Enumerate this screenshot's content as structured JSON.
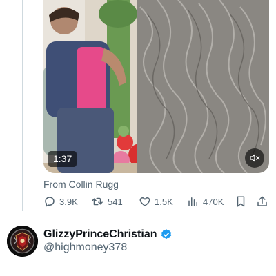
{
  "tweet": {
    "video": {
      "duration": "1:37",
      "mute_icon": "volume-muted-icon"
    },
    "source_text": "From Collin Rugg",
    "actions": {
      "replies": "3.9K",
      "reposts": "541",
      "likes": "1.5K",
      "views": "470K",
      "icons": [
        "reply-icon",
        "repost-icon",
        "like-icon",
        "views-icon",
        "bookmark-icon",
        "share-icon"
      ]
    }
  },
  "next_tweet": {
    "display_name": "GlizzyPrinceChristian",
    "handle": "@highmoney378",
    "verified": true,
    "verified_color": "#1d9bf0"
  },
  "colors": {
    "text_primary": "#0f1419",
    "text_secondary": "#536471",
    "thread_line": "#cfd9de"
  }
}
